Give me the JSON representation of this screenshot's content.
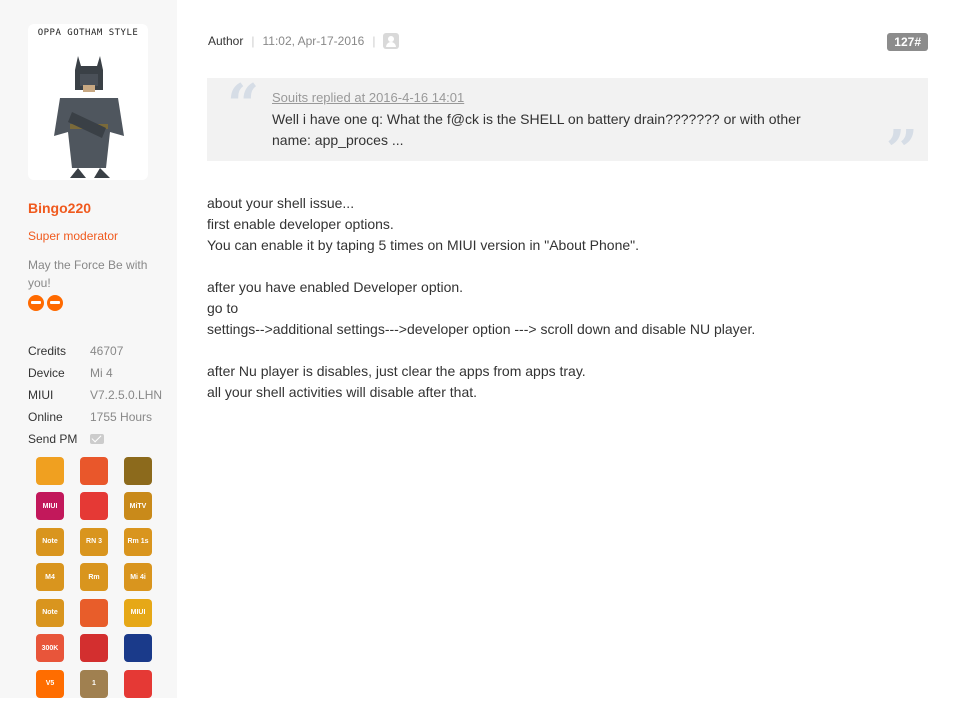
{
  "profile": {
    "avatar_caption": "OPPA GOTHAM STYLE",
    "username": "Bingo220",
    "group": "Super moderator",
    "motto": "May the Force Be with you!",
    "stats": [
      {
        "label": "Credits",
        "value": "46707"
      },
      {
        "label": "Device",
        "value": "Mi 4"
      },
      {
        "label": "MIUI",
        "value": "V7.2.5.0.LHN"
      },
      {
        "label": "Online",
        "value": "1755 Hours"
      }
    ],
    "send_pm_label": "Send PM",
    "medals": [
      {
        "icon": "wrench-medal-icon",
        "text": "",
        "color": "#f0a020"
      },
      {
        "icon": "ring-medal-icon",
        "text": "",
        "color": "#e9572b"
      },
      {
        "icon": "star-medal-icon",
        "text": "",
        "color": "#8c6a1c"
      },
      {
        "icon": "miui-medal-icon",
        "text": "MIUI",
        "color": "#c2185b"
      },
      {
        "icon": "star-burst-medal-icon",
        "text": "",
        "color": "#e53935"
      },
      {
        "icon": "mitv-medal-icon",
        "text": "MiTV",
        "color": "#c98a1a"
      },
      {
        "icon": "note-phone-medal-icon",
        "text": "Note",
        "color": "#d9951e"
      },
      {
        "icon": "rn3-phone-medal-icon",
        "text": "RN 3",
        "color": "#d9951e"
      },
      {
        "icon": "rm1s-phone-medal-icon",
        "text": "Rm 1s",
        "color": "#d9951e"
      },
      {
        "icon": "m4-phone-medal-icon",
        "text": "M4",
        "color": "#d9951e"
      },
      {
        "icon": "rm-phone-medal-icon",
        "text": "Rm",
        "color": "#d9951e"
      },
      {
        "icon": "mi4i-phone-medal-icon",
        "text": "Mi 4i",
        "color": "#d9951e"
      },
      {
        "icon": "note-tablet-medal-icon",
        "text": "Note",
        "color": "#d9951e"
      },
      {
        "icon": "heart-medal-icon",
        "text": "",
        "color": "#e85d2a"
      },
      {
        "icon": "masks-medal-icon",
        "text": "MIUI",
        "color": "#e6a817"
      },
      {
        "icon": "300k-medal-icon",
        "text": "300K",
        "color": "#e8553a"
      },
      {
        "icon": "santa-medal-icon",
        "text": "",
        "color": "#d32f2f"
      },
      {
        "icon": "malaysia-flag-medal-icon",
        "text": "",
        "color": "#1a3a8a"
      },
      {
        "icon": "v5-medal-icon",
        "text": "V5",
        "color": "#ff6d00"
      },
      {
        "icon": "number-one-medal-icon",
        "text": "1",
        "color": "#a08050"
      },
      {
        "icon": "indonesia-flag-medal-icon",
        "text": "",
        "color": "#e53935"
      }
    ]
  },
  "post": {
    "author_label": "Author",
    "time": "11:02, Apr-17-2016",
    "floor": "127#",
    "quote": {
      "ref": "Souits replied at 2016-4-16 14:01",
      "text": "Well i have one q: What the f@ck is the SHELL on battery drain??????? or with other name: app_proces ..."
    },
    "body": [
      "about your shell issue...",
      "first enable developer options.",
      "You can enable it by taping 5 times on MIUI version in \"About Phone\".",
      "",
      "after you have enabled Developer option.",
      "go to",
      "settings-->additional settings--->developer option ---> scroll down and disable NU player.",
      "",
      "after Nu player is disables, just clear the apps from apps tray.",
      "all your shell activities will disable after that."
    ]
  }
}
